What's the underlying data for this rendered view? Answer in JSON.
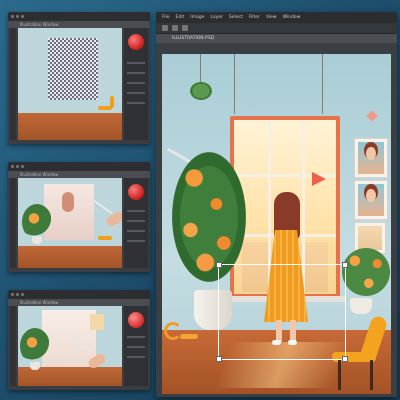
{
  "main_window": {
    "menu": [
      "File",
      "Edit",
      "Image",
      "Layer",
      "Select",
      "Filter",
      "View",
      "Window"
    ],
    "doc_tab": "ILLUSTRATION.PSD"
  },
  "thumb1": {
    "doc_tab": "Illustration Window"
  },
  "thumb2": {
    "doc_tab": "Illustration Window"
  },
  "thumb3": {
    "doc_tab": "Illustration Window"
  },
  "colors": {
    "background": "#1f5070",
    "wall": "#b8d4db",
    "floor": "#c06838",
    "accent_orange": "#f4a31e",
    "window_frame": "#e7724a"
  },
  "icons": [
    "color-picker-icon",
    "pen-icon",
    "hand-icon"
  ]
}
